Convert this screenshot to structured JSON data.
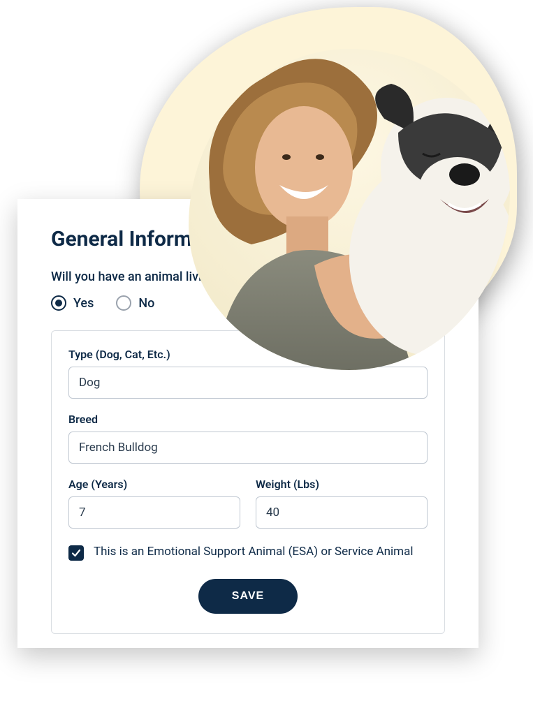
{
  "card": {
    "title": "General Information",
    "question": "Will you have an animal living with you?",
    "radios": {
      "yes": "Yes",
      "no": "No",
      "selected": "yes"
    },
    "fields": {
      "type": {
        "label": "Type (Dog, Cat, Etc.)",
        "value": "Dog"
      },
      "breed": {
        "label": "Breed",
        "value": "French Bulldog"
      },
      "age": {
        "label": "Age (Years)",
        "value": "7"
      },
      "weight": {
        "label": "Weight (Lbs)",
        "value": "40"
      }
    },
    "esa_checkbox": {
      "checked": true,
      "label": "This is an Emotional Support Animal (ESA) or Service Animal"
    },
    "save_label": "SAVE"
  },
  "colors": {
    "primary": "#0e2a47",
    "blob": "#fdf4d8"
  }
}
